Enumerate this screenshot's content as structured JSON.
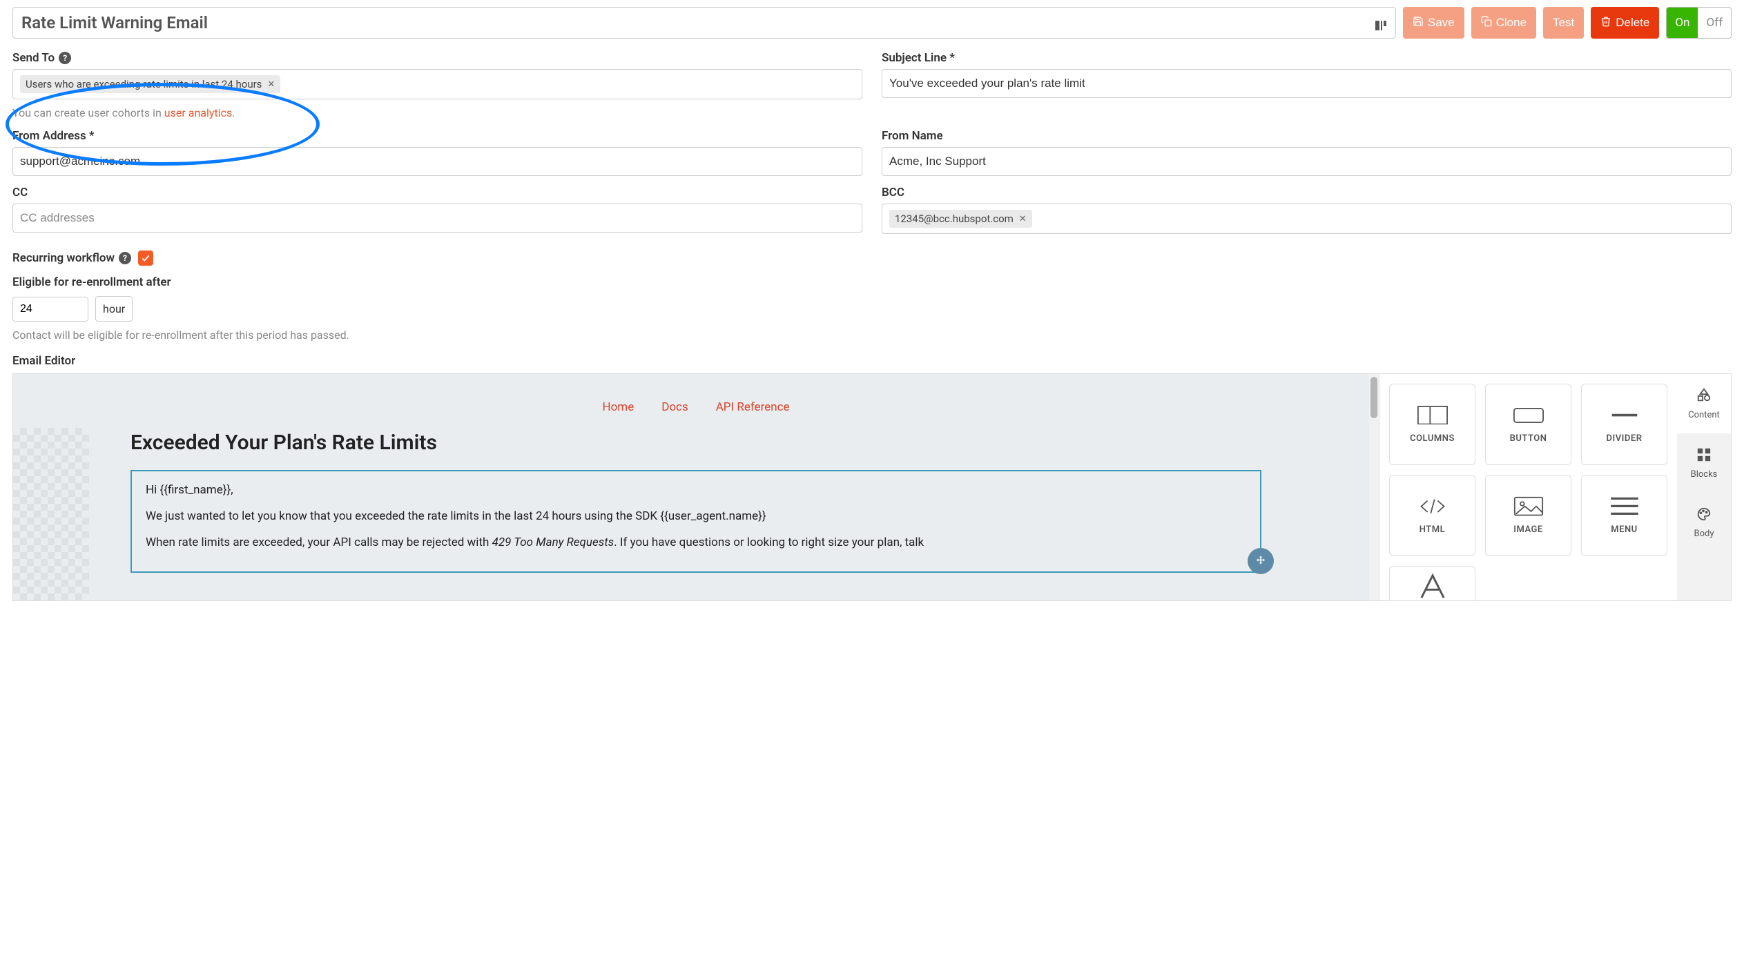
{
  "toolbar": {
    "title": "Rate Limit Warning Email",
    "save": "Save",
    "clone": "Clone",
    "test": "Test",
    "delete": "Delete",
    "toggle_on": "On",
    "toggle_off": "Off"
  },
  "fields": {
    "send_to": {
      "label": "Send To",
      "chip": "Users who are exceeding rate limits in last 24 hours",
      "hint_prefix": "You can create user cohorts in ",
      "hint_link": "user analytics",
      "hint_suffix": "."
    },
    "subject": {
      "label": "Subject Line *",
      "value": "You've exceeded your plan's rate limit"
    },
    "from_address": {
      "label": "From Address *",
      "value": "support@acmeinc.com"
    },
    "from_name": {
      "label": "From Name",
      "value": "Acme, Inc Support"
    },
    "cc": {
      "label": "CC",
      "placeholder": "CC addresses"
    },
    "bcc": {
      "label": "BCC",
      "chip": "12345@bcc.hubspot.com"
    },
    "recurring": {
      "label": "Recurring workflow",
      "checked": true
    },
    "reenroll": {
      "label": "Eligible for re-enrollment after",
      "value": "24",
      "unit": "hour",
      "hint": "Contact will be eligible for re-enrollment after this period has passed."
    }
  },
  "editor": {
    "label": "Email Editor",
    "nav": {
      "home": "Home",
      "docs": "Docs",
      "api": "API Reference"
    },
    "heading": "Exceeded Your Plan's Rate Limits",
    "body": {
      "greet": "Hi {{first_name}},",
      "p1": "We just wanted to let you know that you exceeded the rate limits in the last 24 hours using the SDK {{user_agent.name}}",
      "p2a": "When rate limits are exceeded, your API calls may be rejected with ",
      "p2i": "429 Too Many Requests",
      "p2b": ". If you have questions or looking to right size your plan, talk"
    },
    "tiles": {
      "columns": "COLUMNS",
      "button": "BUTTON",
      "divider": "DIVIDER",
      "html": "HTML",
      "image": "IMAGE",
      "menu": "MENU"
    },
    "tabs": {
      "content": "Content",
      "blocks": "Blocks",
      "body": "Body"
    }
  }
}
